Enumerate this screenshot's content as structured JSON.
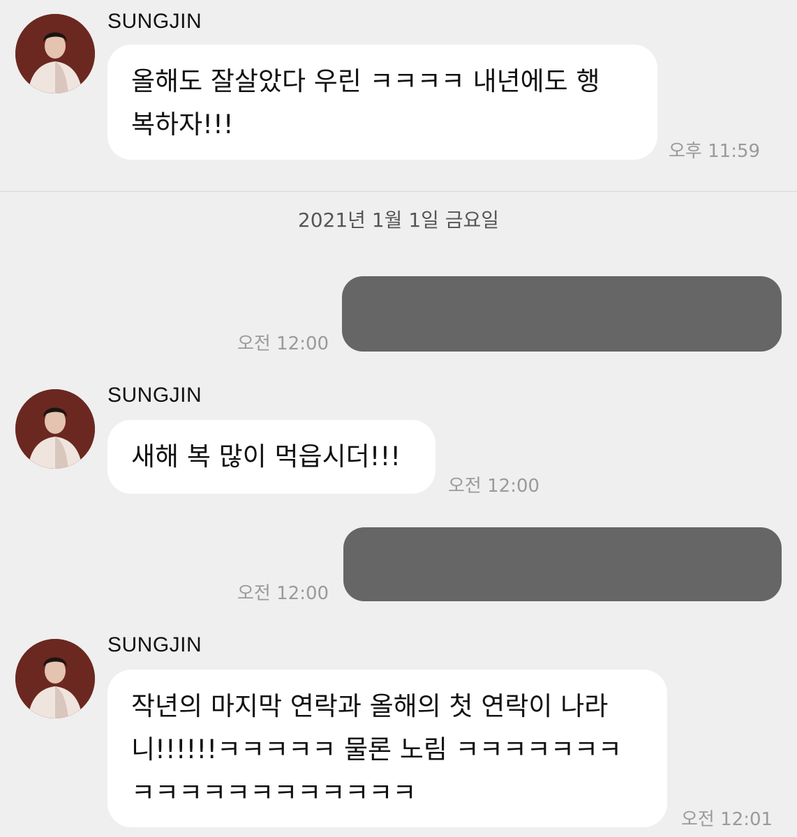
{
  "date_separator": "2021년 1월 1일 금요일",
  "messages": [
    {
      "sender": "SUNGJIN",
      "text": "올해도 잘살았다 우린 ㅋㅋㅋㅋ 내년에도 행\n복하자!!!",
      "time": "오후 11:59"
    },
    {
      "sender": "me",
      "text": "",
      "redacted": true,
      "time": "오전 12:00"
    },
    {
      "sender": "SUNGJIN",
      "text": "새해 복 많이 먹읍시더!!!",
      "time": "오전 12:00"
    },
    {
      "sender": "me",
      "text": "",
      "redacted": true,
      "time": "오전 12:00"
    },
    {
      "sender": "SUNGJIN",
      "text": "작년의 마지막 연락과 올해의 첫 연락이 나라\n니!!!!!!ㅋㅋㅋㅋㅋ 물론 노림 ㅋㅋㅋㅋㅋㅋㅋ\nㅋㅋㅋㅋㅋㅋㅋㅋㅋㅋㅋㅋ",
      "time": "오전 12:01"
    }
  ]
}
